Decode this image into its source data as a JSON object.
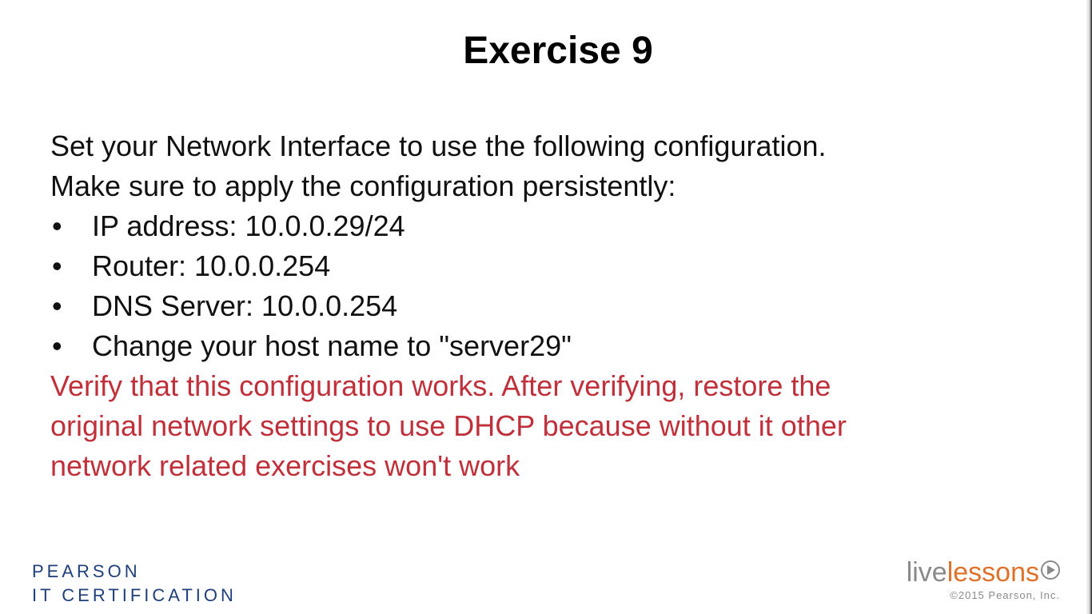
{
  "slide": {
    "title": "Exercise 9",
    "intro": [
      "Set your Network Interface to use the following configuration.",
      "Make sure to apply the configuration persistently:"
    ],
    "bullets": [
      "IP address: 10.0.0.29/24",
      "Router: 10.0.0.254",
      "DNS Server: 10.0.0.254",
      "Change your host name to \"server29\""
    ],
    "bullet_glyph": "•",
    "warning": [
      "Verify that this configuration works. After verifying, restore the",
      "original network settings to use DHCP because without it other",
      "network related exercises won't work"
    ]
  },
  "footer": {
    "publisher_line1": "PEARSON",
    "publisher_line2": "IT CERTIFICATION",
    "brand_part1": "live",
    "brand_part2": "lessons",
    "copyright": "©2015 Pearson, Inc."
  },
  "colors": {
    "background": "#ffffff",
    "text": "#111111",
    "warning": "#c0303a",
    "pearson_blue": "#1f3f7a",
    "brand_gray": "#8a8a8a",
    "brand_orange": "#e0712a"
  },
  "icons": {
    "play": "play-circle-icon"
  }
}
